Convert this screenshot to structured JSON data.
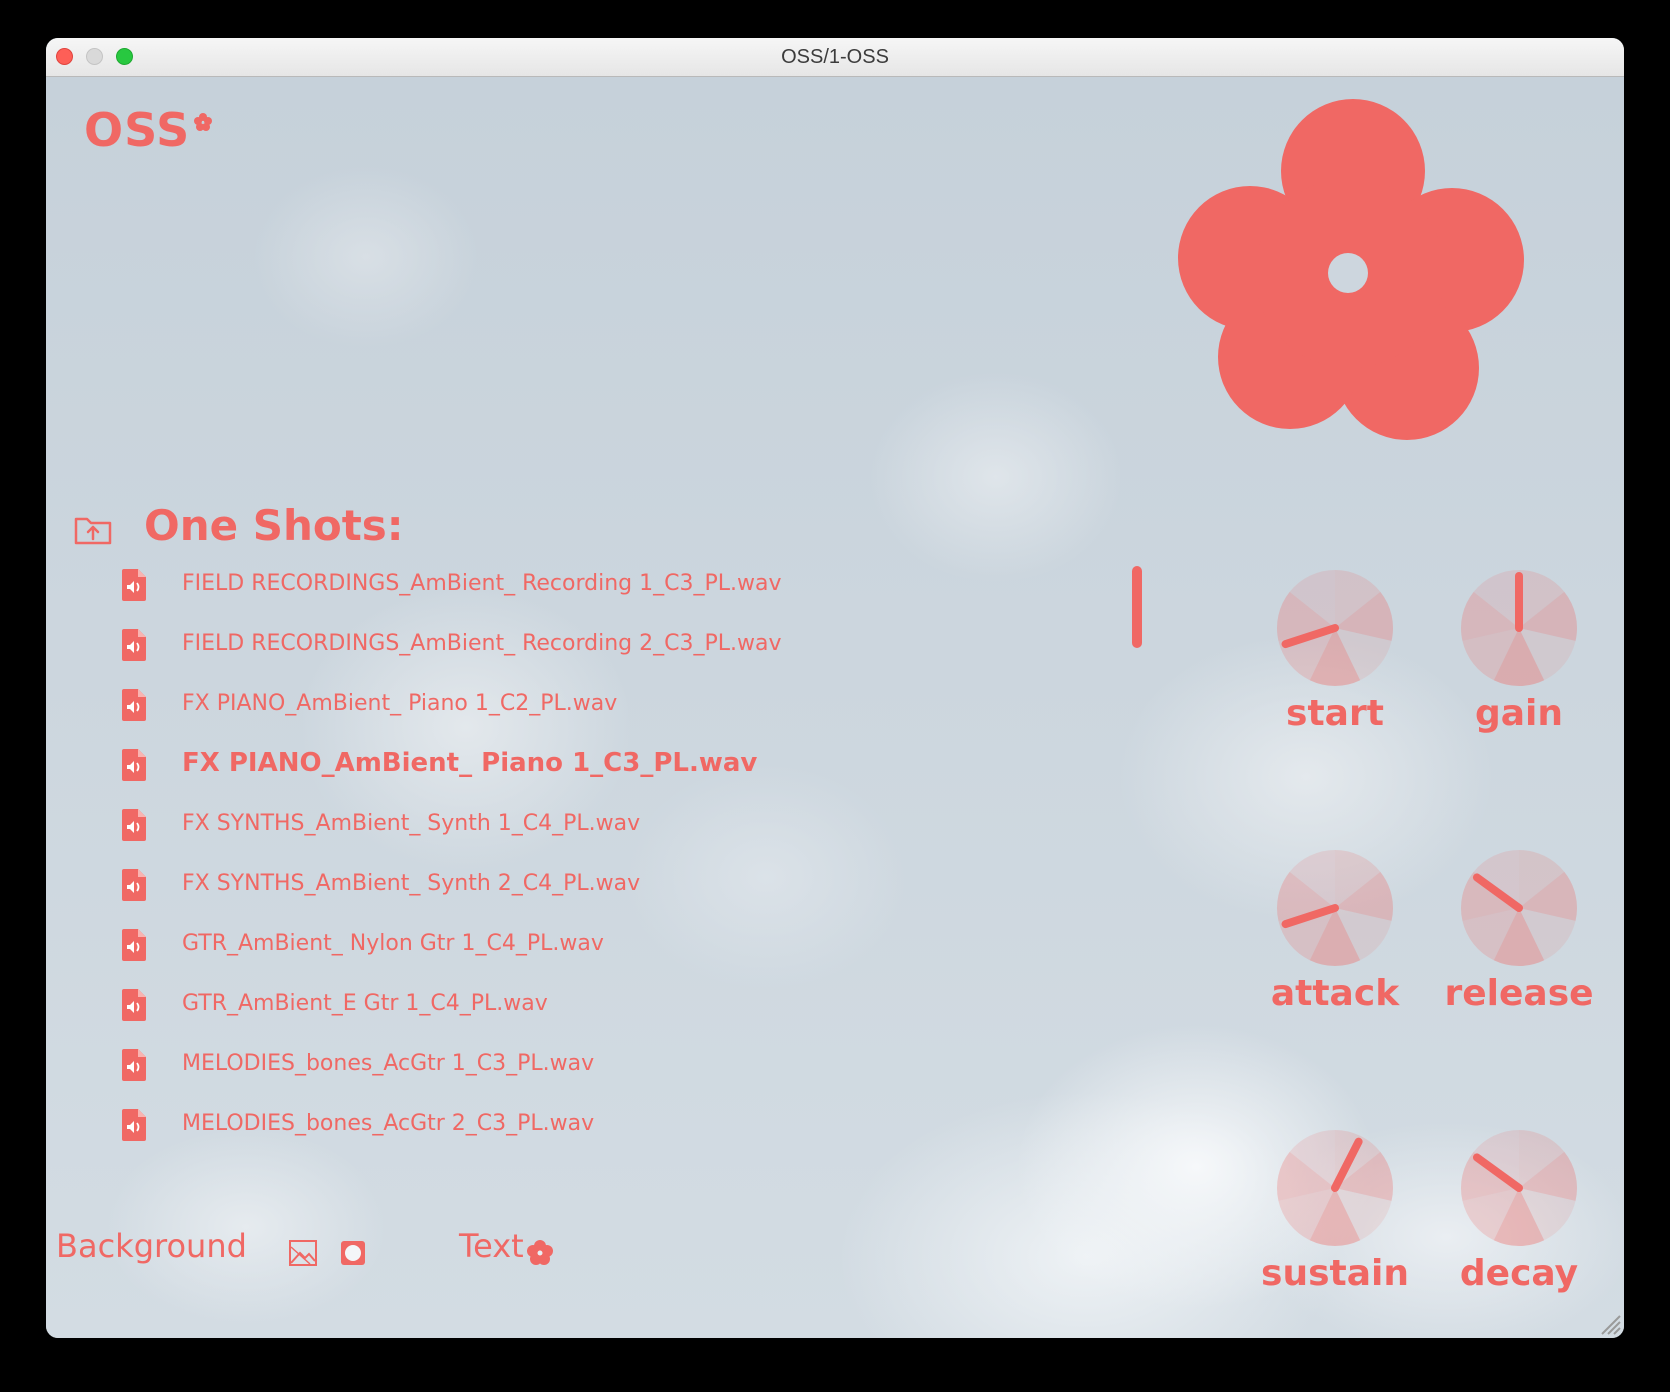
{
  "window": {
    "title": "OSS/1-OSS"
  },
  "app": {
    "logo": "OSS"
  },
  "browser": {
    "title": "One Shots:",
    "selected_index": 3,
    "files": [
      "FIELD RECORDINGS_AmBient_ Recording 1_C3_PL.wav",
      "FIELD RECORDINGS_AmBient_ Recording 2_C3_PL.wav",
      "FX PIANO_AmBient_ Piano 1_C2_PL.wav",
      "FX PIANO_AmBient_ Piano 1_C3_PL.wav",
      "FX SYNTHS_AmBient_ Synth 1_C4_PL.wav",
      "FX SYNTHS_AmBient_ Synth 2_C4_PL.wav",
      "GTR_AmBient_ Nylon Gtr 1_C4_PL.wav",
      "GTR_AmBient_E Gtr 1_C4_PL.wav",
      "MELODIES_bones_AcGtr 1_C3_PL.wav",
      "MELODIES_bones_AcGtr 2_C3_PL.wav"
    ]
  },
  "knobs": {
    "start": {
      "label": "start",
      "value": 0.1
    },
    "gain": {
      "label": "gain",
      "value": 0.5
    },
    "attack": {
      "label": "attack",
      "value": 0.1
    },
    "release": {
      "label": "release",
      "value": 0.3
    },
    "sustain": {
      "label": "sustain",
      "value": 0.6
    },
    "decay": {
      "label": "decay",
      "value": 0.3
    }
  },
  "vertical_slider": {
    "value": 1.0
  },
  "footer": {
    "background_label": "Background",
    "text_label": "Text"
  },
  "colors": {
    "accent": "#f06864",
    "sky": "#c9d3dc"
  },
  "icons": {
    "folder": "folder-upload-icon",
    "file": "audio-file-icon",
    "bg_image": "image-icon",
    "bg_color": "square-color-icon",
    "text_color": "flower-color-icon"
  }
}
